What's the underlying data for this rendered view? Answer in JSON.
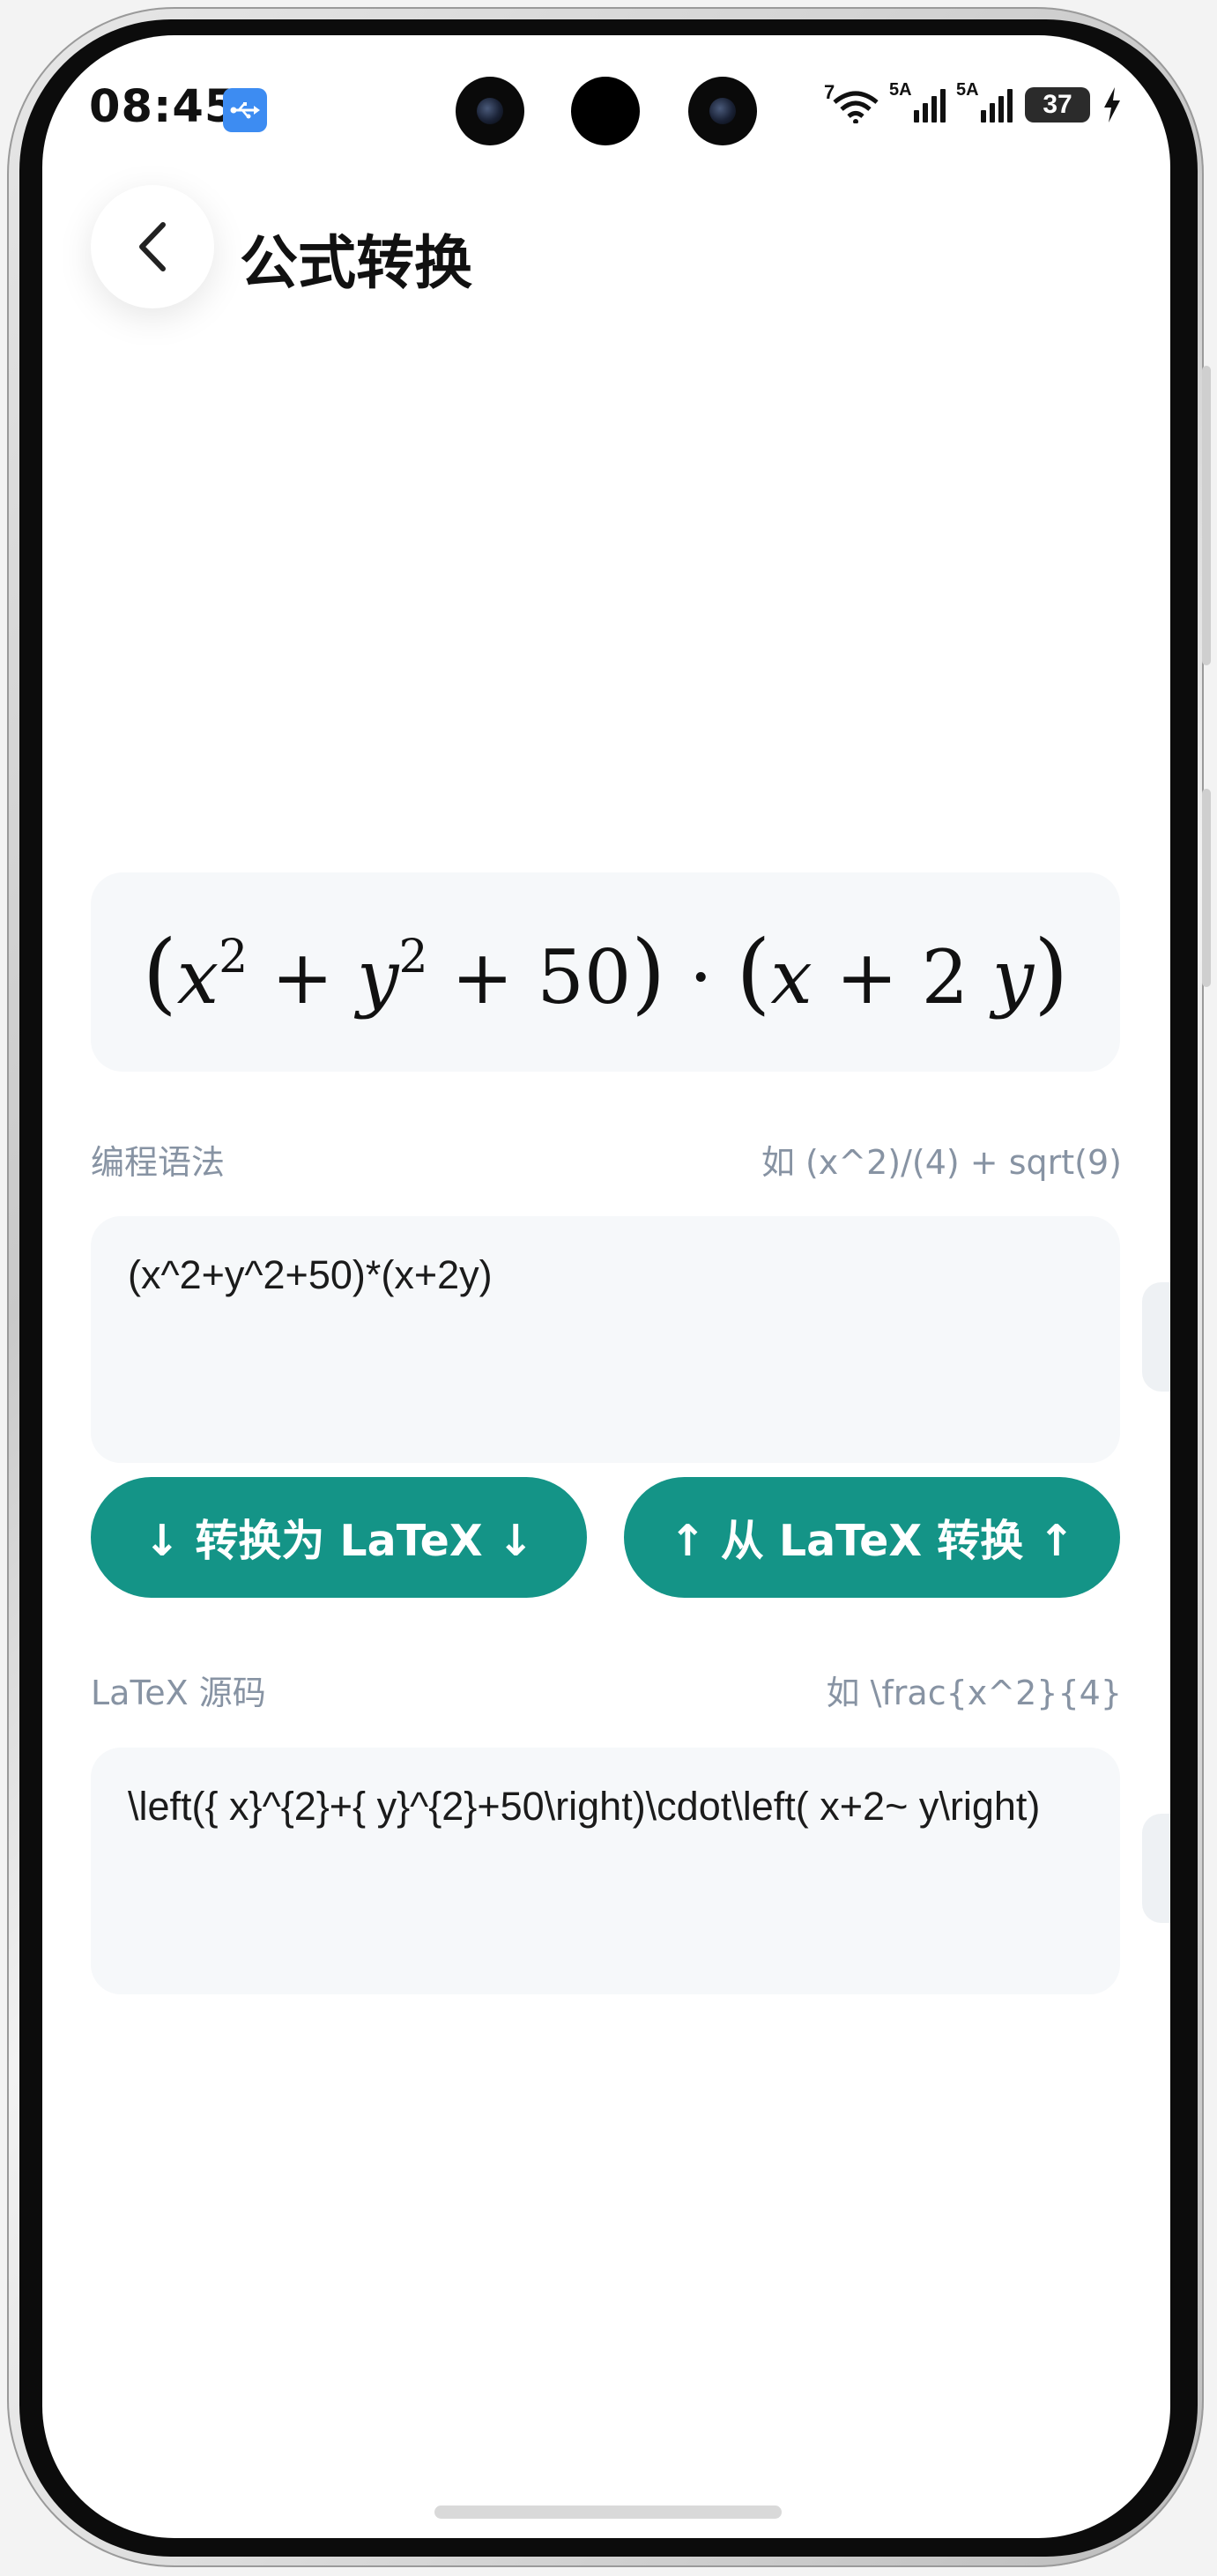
{
  "status_bar": {
    "time": "08:45",
    "usb_icon": "usb-icon",
    "wifi_icon": "wifi-icon",
    "wifi_tag": "7",
    "signal_1_tag": "5A",
    "signal_2_tag": "5A",
    "battery": "37",
    "charging_icon": "bolt-icon"
  },
  "header": {
    "title": "公式转换",
    "back_icon": "chevron-left-icon"
  },
  "preview": {
    "lparen": "(",
    "x": "x",
    "exp1": "2",
    "plus1": " + ",
    "y": "y",
    "exp2": "2",
    "plus2": " + 50",
    "rparen": ")",
    "dot": " · ",
    "lparen2": "(",
    "x2": "x",
    "plus3": " + 2 ",
    "y2": "y",
    "rparen2": ")"
  },
  "programming": {
    "label": "编程语法",
    "hint": "如 (x^2)/(4) + sqrt(9)",
    "value": "(x^2+y^2+50)*(x+2y)"
  },
  "buttons": {
    "to_latex": "↓ 转换为 LaTeX ↓",
    "from_latex": "↑ 从 LaTeX 转换 ↑"
  },
  "latex": {
    "label": "LaTeX 源码",
    "hint": "如 \\frac{x^2}{4}",
    "value": "\\left({ x}^{2}+{ y}^{2}+50\\right)\\cdot\\left( x+2~ y\\right)"
  },
  "colors": {
    "accent": "#149487",
    "field_bg": "#f6f8fa",
    "label": "#8793a3"
  }
}
